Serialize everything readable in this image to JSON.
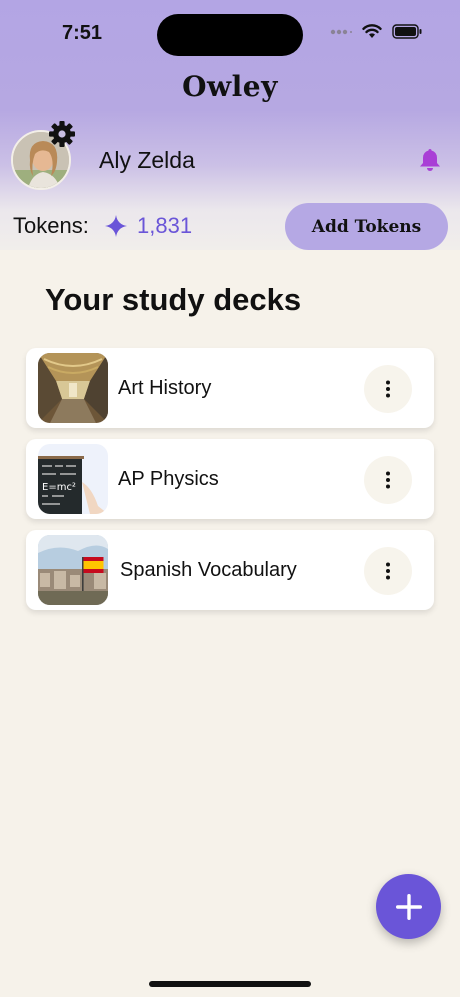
{
  "status_bar": {
    "time": "7:51"
  },
  "header": {
    "title": "Owley"
  },
  "user": {
    "name": "Aly Zelda"
  },
  "tokens": {
    "label": "Tokens:",
    "count": "1,831",
    "add_button_label": "Add Tokens"
  },
  "section": {
    "title": "Your study decks"
  },
  "decks": [
    {
      "label": "Art History",
      "thumbnail": "art-history-thumbnail"
    },
    {
      "label": "AP Physics",
      "thumbnail": "ap-physics-thumbnail"
    },
    {
      "label": "Spanish Vocabulary",
      "thumbnail": "spanish-vocabulary-thumbnail"
    }
  ],
  "icons": {
    "settings": "gear-icon",
    "notifications": "bell-icon",
    "tokens": "sparkle-icon",
    "deck_menu": "more-vertical-icon",
    "fab": "plus-icon"
  },
  "colors": {
    "accent": "#6a55d8",
    "header_gradient_top": "#b3a5e4",
    "button_bg": "#b5a8e4",
    "bell": "#a93fd6",
    "background": "#f6f2ea"
  }
}
